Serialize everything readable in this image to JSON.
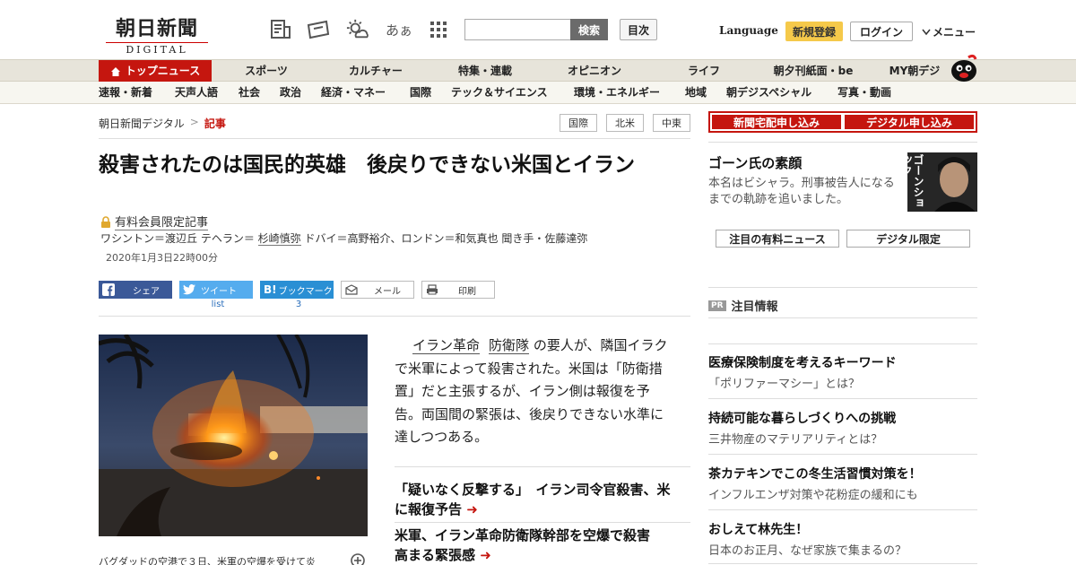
{
  "header": {
    "logo_main": "朝日新聞",
    "logo_sub": "DIGITAL",
    "search_placeholder": "",
    "search_button": "検索",
    "index_button": "目次",
    "language": "Language",
    "register": "新規登録",
    "login": "ログイン",
    "menu": "メニュー",
    "font_toggle": "あぁ"
  },
  "nav_main": [
    {
      "label": "トップニュース"
    },
    {
      "label": "スポーツ"
    },
    {
      "label": "カルチャー"
    },
    {
      "label": "特集・連載"
    },
    {
      "label": "オピニオン"
    },
    {
      "label": "ライフ"
    },
    {
      "label": "朝夕刊紙面・be"
    },
    {
      "label": "MY朝デジ"
    }
  ],
  "nav_sub": [
    {
      "label": "速報・新着"
    },
    {
      "label": "天声人語"
    },
    {
      "label": "社会"
    },
    {
      "label": "政治"
    },
    {
      "label": "経済・マネー"
    },
    {
      "label": "国際"
    },
    {
      "label": "テック＆サイエンス"
    },
    {
      "label": "環境・エネルギー"
    },
    {
      "label": "地域"
    },
    {
      "label": "朝デジスペシャル"
    },
    {
      "label": "写真・動画"
    }
  ],
  "breadcrumb": {
    "home": "朝日新聞デジタル",
    "sep": ">",
    "current": "記事"
  },
  "tags": [
    "国際",
    "北米",
    "中東"
  ],
  "article": {
    "headline": "殺害されたのは国民的英雄　後戻りできない米国とイラン",
    "members_only": "有料会員限定記事",
    "byline_prefix": "ワシントン＝渡辺丘 テヘラン＝",
    "byline_link": "杉崎慎弥",
    "byline_suffix": "ドバイ＝高野裕介、ロンドン＝和気真也 聞き手・佐藤達弥",
    "date": "2020年1月3日22時00分",
    "lead_link1": "イラン革命",
    "lead_link2": "防衛隊",
    "lead_text": "の要人が、隣国イラクで米軍によって殺害された。米国は「防衛措置」だと主張するが、イラン側は報復を予告。両国間の緊張は、後戻りできない水準に達しつつある。",
    "caption": "バグダッドの空港で３日、米軍の空爆を受けて炎"
  },
  "share": {
    "facebook": "シェア",
    "twitter": "ツイート",
    "twitter_count": "list",
    "hatena": "ブックマーク",
    "hatena_count": "3",
    "mail": "メール",
    "print": "印刷"
  },
  "related": [
    {
      "text": "「疑いなく反撃する」　イラン司令官殺害、米に報復予告"
    },
    {
      "text": "米軍、イラン革命防衛隊幹部を空爆で殺害　高まる緊張感"
    }
  ],
  "sidebar": {
    "subscribe_paper": "新聞宅配申し込み",
    "subscribe_digital": "デジタル申し込み",
    "ghosn_title": "ゴーン氏の素顔",
    "ghosn_desc": "本名はビシャラ。刑事被告人になるまでの軌跡を追いました。",
    "ghosn_img_text": "ゴーンショック",
    "pick_paid": "注目の有料ニュース",
    "pick_digital": "デジタル限定",
    "pr_badge": "PR",
    "pr_heading": "注目情報",
    "pr_items": [
      {
        "title": "医療保険制度を考えるキーワード",
        "sub": "「ポリファーマシー」とは？"
      },
      {
        "title": "持続可能な暮らしづくりへの挑戦",
        "sub": "三井物産のマテリアリティとは？"
      },
      {
        "title": "茶カテキンでこの冬生活習慣対策を！",
        "sub": "インフルエンザ対策や花粉症の緩和にも"
      },
      {
        "title": "おしえて林先生！",
        "sub": "日本のお正月、なぜ家族で集まるの？"
      }
    ]
  },
  "colors": {
    "brand_red": "#c5160f",
    "register_yellow": "#f5c94a",
    "facebook": "#3b5998",
    "twitter": "#55acee",
    "hatena": "#2a8fd4"
  }
}
